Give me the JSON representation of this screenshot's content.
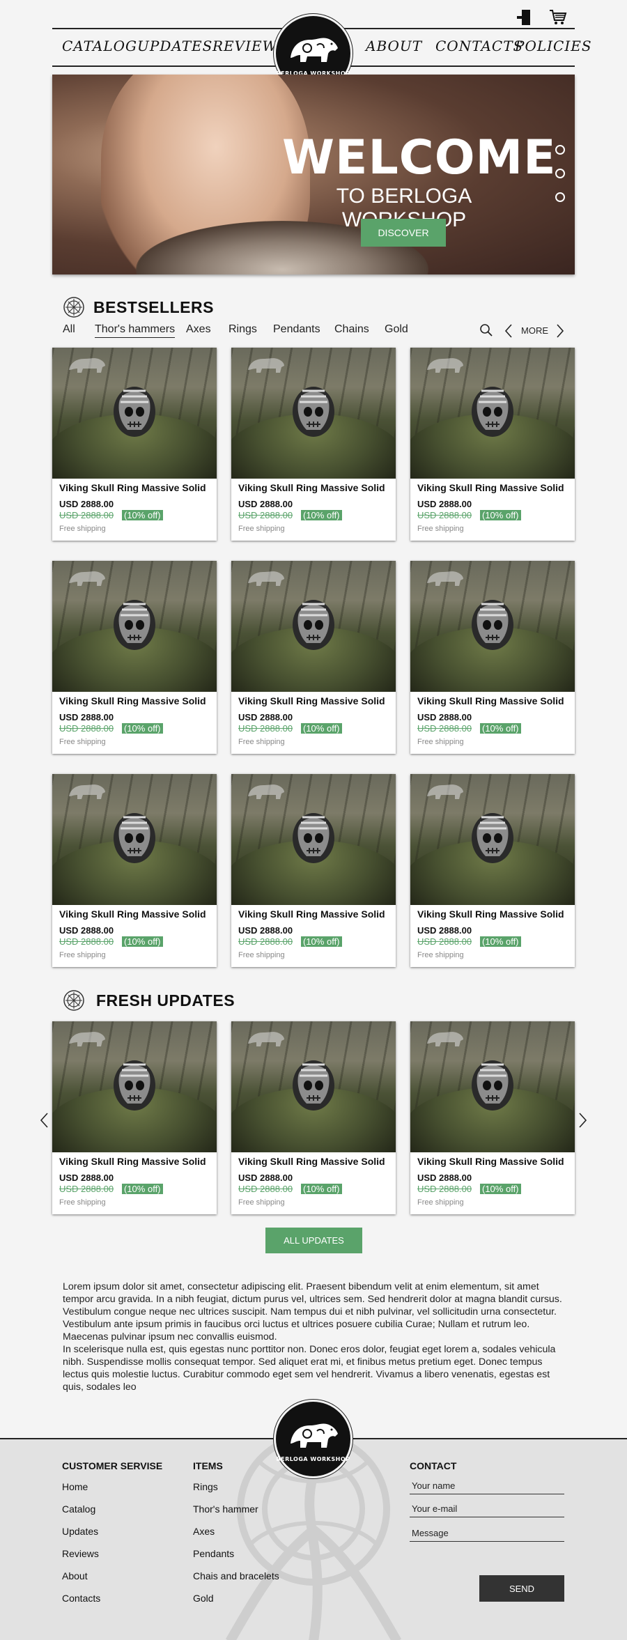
{
  "header": {
    "nav_left": [
      "Catalog",
      "Updates",
      "Reviews"
    ],
    "nav_right": [
      "About",
      "Contacts",
      "Policies"
    ],
    "logo_text": "Berloga Workshop",
    "icons": [
      "login-icon",
      "cart-icon"
    ]
  },
  "hero": {
    "title": "WELCOME",
    "subtitle": "TO BERLOGA WORKSHOP",
    "button": "DISCOVER",
    "slides": 3
  },
  "bestsellers": {
    "title": "BESTSELLERS",
    "filters": [
      "All",
      "Thor's hammers",
      "Axes",
      "Rings",
      "Pendants",
      "Chains",
      "Gold"
    ],
    "active_filter": "Thor's hammers",
    "more": "MORE"
  },
  "product": {
    "name": "Viking Skull Ring Massive Solid",
    "price": "USD 2888.00",
    "old_price": "USD 2888.00",
    "discount": "(10% off)",
    "shipping": "Free shipping"
  },
  "updates": {
    "title": "FRESH UPDATES",
    "button": "ALL UPDATES"
  },
  "about": {
    "p1": "Lorem ipsum dolor sit amet, consectetur adipiscing elit. Praesent bibendum velit at enim elementum, sit amet tempor arcu gravida. In a nibh feugiat, dictum purus vel, ultrices sem. Sed hendrerit dolor at magna blandit cursus. Vestibulum congue neque nec ultrices suscipit. Nam tempus dui et nibh pulvinar, vel sollicitudin urna consectetur. Vestibulum ante ipsum primis in faucibus orci luctus et ultrices posuere cubilia Curae; Nullam et rutrum leo. Maecenas pulvinar ipsum nec convallis euismod.",
    "p2": "In scelerisque nulla est, quis egestas nunc porttitor non. Donec eros dolor, feugiat eget lorem a, sodales vehicula nibh. Suspendisse mollis consequat tempor. Sed aliquet erat mi, et finibus metus pretium eget. Donec tempus lectus quis molestie luctus. Curabitur commodo eget sem vel hendrerit. Vivamus a libero venenatis, egestas est quis, sodales leo"
  },
  "footer": {
    "service_title": "CUSTOMER SERVISE",
    "service_links": [
      "Home",
      "Catalog",
      "Updates",
      "Reviews",
      "About",
      "Contacts"
    ],
    "items_title": "ITEMS",
    "items_links": [
      "Rings",
      "Thor's hammer",
      "Axes",
      "Pendants",
      "Chais and bracelets",
      "Gold"
    ],
    "contact_title": "CONTACT",
    "name_placeholder": "Your name",
    "email_placeholder": "Your e-mail",
    "message_placeholder": "Message",
    "send": "SEND"
  },
  "colors": {
    "accent": "#5aa36a",
    "dark": "#111111",
    "background": "#f4f4f4"
  }
}
